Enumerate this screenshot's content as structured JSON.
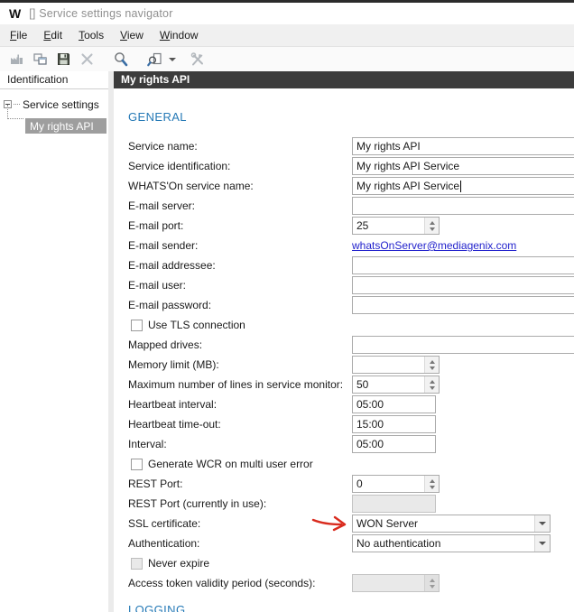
{
  "window": {
    "logo": "W",
    "title": "[] Service settings navigator"
  },
  "menu": {
    "items": [
      "File",
      "Edit",
      "Tools",
      "View",
      "Window"
    ]
  },
  "toolbar": {
    "icons": [
      "factory-icon",
      "cascade-windows-icon",
      "save-icon",
      "delete-icon",
      "search-icon",
      "search-document-icon",
      "tools-icon"
    ]
  },
  "sidebar": {
    "header": "Identification",
    "tree": {
      "root": "Service settings",
      "child": "My rights API"
    }
  },
  "main": {
    "header": "My rights API",
    "sections": {
      "general": "GENERAL",
      "logging": "LOGGING"
    },
    "fields": {
      "service_name": {
        "label": "Service name:",
        "value": "My rights API"
      },
      "service_identification": {
        "label": "Service identification:",
        "value": "My rights API Service"
      },
      "whatson_service_name": {
        "label": "WHATS'On service name:",
        "value": "My rights API Service"
      },
      "email_server": {
        "label": "E-mail server:",
        "value": ""
      },
      "email_port": {
        "label": "E-mail port:",
        "value": "25"
      },
      "email_sender": {
        "label": "E-mail sender:",
        "value": "whatsOnServer@mediagenix.com"
      },
      "email_addressee": {
        "label": "E-mail addressee:",
        "value": ""
      },
      "email_user": {
        "label": "E-mail user:",
        "value": ""
      },
      "email_password": {
        "label": "E-mail password:",
        "value": ""
      },
      "use_tls": {
        "label": "Use TLS connection",
        "checked": false
      },
      "mapped_drives": {
        "label": "Mapped drives:",
        "value": ""
      },
      "memory_limit": {
        "label": "Memory limit (MB):",
        "value": ""
      },
      "max_lines": {
        "label": "Maximum number of lines in service monitor:",
        "value": "50"
      },
      "heartbeat_interval": {
        "label": "Heartbeat interval:",
        "value": "05:00"
      },
      "heartbeat_timeout": {
        "label": "Heartbeat time-out:",
        "value": "15:00"
      },
      "interval": {
        "label": "Interval:",
        "value": "05:00"
      },
      "generate_wcr": {
        "label": "Generate WCR on multi user error",
        "checked": false
      },
      "rest_port": {
        "label": "REST Port:",
        "value": "0"
      },
      "rest_port_in_use": {
        "label": "REST Port (currently in use):",
        "value": "",
        "disabled": true
      },
      "ssl_certificate": {
        "label": "SSL certificate:",
        "value": "WON Server"
      },
      "authentication": {
        "label": "Authentication:",
        "value": "No authentication"
      },
      "never_expire": {
        "label": "Never expire",
        "checked": false,
        "disabled": true
      },
      "access_token_validity": {
        "label": "Access token validity period (seconds):",
        "value": "",
        "disabled": true
      }
    }
  },
  "annotation": {
    "type": "hand-drawn-arrow",
    "points_to": "SSL certificate dropdown",
    "color": "#d92b1e"
  },
  "colors": {
    "accent_blue": "#2579b6",
    "header_dark": "#3c3c3c",
    "selection_gray": "#9e9e9e",
    "link_blue": "#2222cc",
    "annotation_red": "#d92b1e"
  }
}
